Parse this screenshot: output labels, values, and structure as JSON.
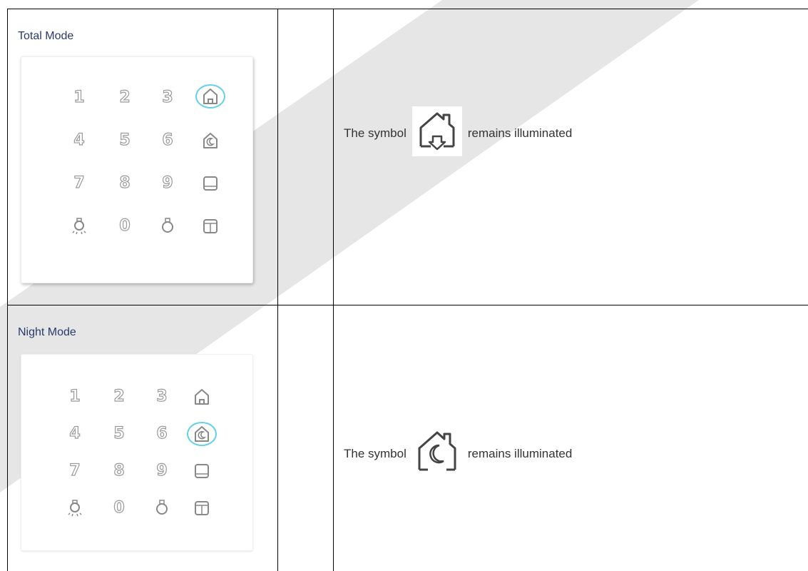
{
  "rows": [
    {
      "mode_title": "Total Mode",
      "desc_before": "The symbol",
      "desc_after": "remains illuminated",
      "symbol_icon": "house-arrow-down-icon",
      "highlighted_key": "house-icon"
    },
    {
      "mode_title": "Night Mode",
      "desc_before": "The symbol",
      "desc_after": "remains illuminated",
      "symbol_icon": "house-moon-icon",
      "highlighted_key": "house-moon-icon"
    }
  ],
  "keypad": {
    "digits": [
      "1",
      "2",
      "3",
      "4",
      "5",
      "6",
      "7",
      "8",
      "9",
      "0"
    ],
    "icons": [
      "house-icon",
      "house-moon-icon",
      "square-icon",
      "bulb-on-icon",
      "bulb-off-icon",
      "split-square-icon"
    ]
  },
  "colors": {
    "highlight_ring": "#63d0ea",
    "title_text": "#2a3a6a",
    "key_outline": "#9a9a9a"
  }
}
